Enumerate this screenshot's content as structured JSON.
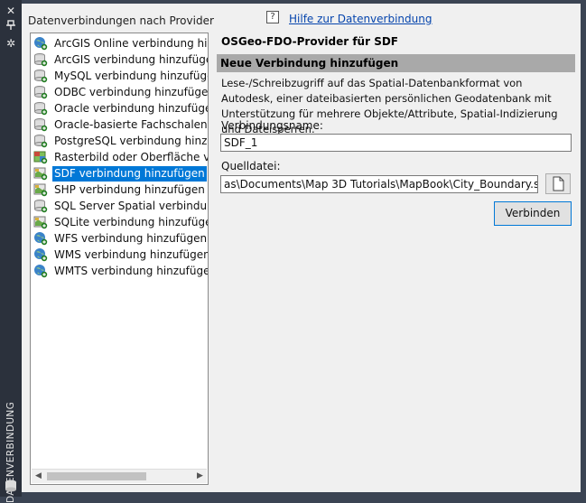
{
  "sidebar": {
    "title": "DATENVERBINDUNG",
    "buttons": [
      "close-icon",
      "pin-icon",
      "settings-icon"
    ]
  },
  "left_panel": {
    "title": "Datenverbindungen nach Provider",
    "items": [
      {
        "label": "ArcGIS Online verbindung hinzufügen",
        "icon": "globe-add-icon"
      },
      {
        "label": "ArcGIS verbindung hinzufügen",
        "icon": "database-add-icon"
      },
      {
        "label": "MySQL verbindung hinzufügen",
        "icon": "database-add-icon"
      },
      {
        "label": "ODBC verbindung hinzufügen",
        "icon": "database-add-icon"
      },
      {
        "label": "Oracle verbindung hinzufügen",
        "icon": "database-add-icon"
      },
      {
        "label": "Oracle-basierte Fachschalen verbindung hinzufügen",
        "icon": "database-add-icon"
      },
      {
        "label": "PostgreSQL verbindung hinzufügen",
        "icon": "database-add-icon"
      },
      {
        "label": "Rasterbild oder Oberfläche verbindung hinzufügen",
        "icon": "raster-add-icon"
      },
      {
        "label": "SDF verbindung hinzufügen",
        "icon": "file-map-add-icon"
      },
      {
        "label": "SHP verbindung hinzufügen",
        "icon": "file-map-add-icon"
      },
      {
        "label": "SQL Server Spatial verbindung hinzufügen",
        "icon": "database-add-icon"
      },
      {
        "label": "SQLite verbindung hinzufügen",
        "icon": "file-map-add-icon"
      },
      {
        "label": "WFS verbindung hinzufügen",
        "icon": "globe-add-icon"
      },
      {
        "label": "WMS verbindung hinzufügen",
        "icon": "globe-add-icon"
      },
      {
        "label": "WMTS verbindung hinzufügen",
        "icon": "globe-add-icon"
      }
    ],
    "selected_index": 8
  },
  "help": {
    "link": "Hilfe zur Datenverbindung"
  },
  "right_panel": {
    "title": "OSGeo-FDO-Provider für SDF",
    "section_header": "Neue Verbindung hinzufügen",
    "description": "Lese-/Schreibzugriff auf das Spatial-Datenbankformat von Autodesk, einer dateibasierten persönlichen Geodatenbank mit Unterstützung für mehrere Objekte/Attribute, Spatial-Indizierung und Dateisperren.",
    "connection_name_label": "Verbindungsname:",
    "connection_name_value": "SDF_1",
    "source_file_label": "Quelldatei:",
    "source_file_value": "as\\Documents\\Map 3D Tutorials\\MapBook\\City_Boundary.sdf",
    "connect_button": "Verbinden"
  },
  "colors": {
    "selection": "#0078d7",
    "link": "#0645ad",
    "section_header_bg": "#a9a9a9"
  }
}
